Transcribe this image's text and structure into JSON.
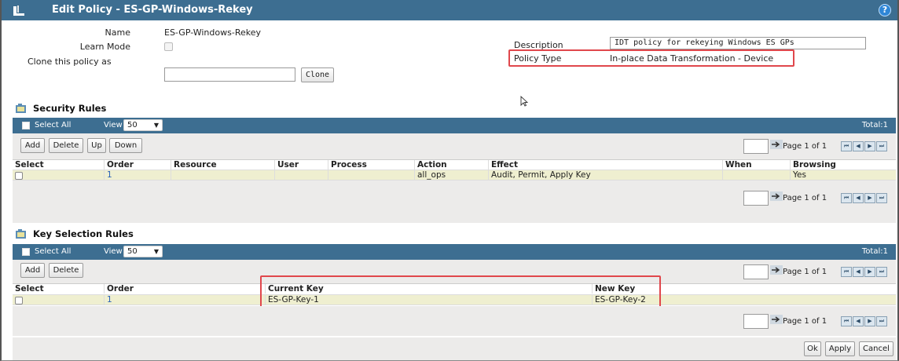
{
  "window": {
    "title": "Edit Policy - ES-GP-Windows-Rekey",
    "help_glyph": "?"
  },
  "form": {
    "name_label": "Name",
    "name_value": "ES-GP-Windows-Rekey",
    "learn_mode_label": "Learn Mode",
    "clone_label": "Clone this policy as",
    "clone_value": "",
    "clone_button": "Clone",
    "description_label": "Description",
    "description_value": "IDT policy for rekeying Windows ES GPs",
    "policy_type_label": "Policy Type",
    "policy_type_value": "In-place Data Transformation - Device"
  },
  "security_rules": {
    "title": "Security Rules",
    "select_all": "Select All",
    "view_label": "View",
    "view_value": "50",
    "total": "Total:1",
    "buttons": {
      "add": "Add",
      "delete": "Delete",
      "up": "Up",
      "down": "Down"
    },
    "pager_text": "Page 1 of 1",
    "columns": [
      "Select",
      "Order",
      "Resource",
      "User",
      "Process",
      "Action",
      "Effect",
      "When",
      "Browsing"
    ],
    "rows": [
      {
        "order": "1",
        "resource": "",
        "user": "",
        "process": "",
        "action": "all_ops",
        "effect": "Audit, Permit, Apply Key",
        "when": "",
        "browsing": "Yes"
      }
    ]
  },
  "key_selection_rules": {
    "title": "Key Selection Rules",
    "select_all": "Select All",
    "view_label": "View",
    "view_value": "50",
    "total": "Total:1",
    "buttons": {
      "add": "Add",
      "delete": "Delete"
    },
    "pager_text": "Page 1 of 1",
    "columns": [
      "Select",
      "Order",
      "Current Key",
      "New Key"
    ],
    "rows": [
      {
        "order": "1",
        "current_key": "ES-GP-Key-1",
        "new_key": "ES-GP-Key-2"
      }
    ]
  },
  "footer": {
    "ok": "Ok",
    "apply": "Apply",
    "cancel": "Cancel"
  },
  "colors": {
    "header_blue": "#3d6e91",
    "highlight_red": "#e0474c",
    "row_fill": "#efefd0",
    "link_blue": "#2b63b7"
  },
  "icons": [
    "policy-icon",
    "help-icon",
    "section-icon",
    "go-arrow-icon",
    "first-page-icon",
    "prev-page-icon",
    "next-page-icon",
    "last-page-icon",
    "mouse-cursor-icon",
    "chevron-down-icon"
  ]
}
